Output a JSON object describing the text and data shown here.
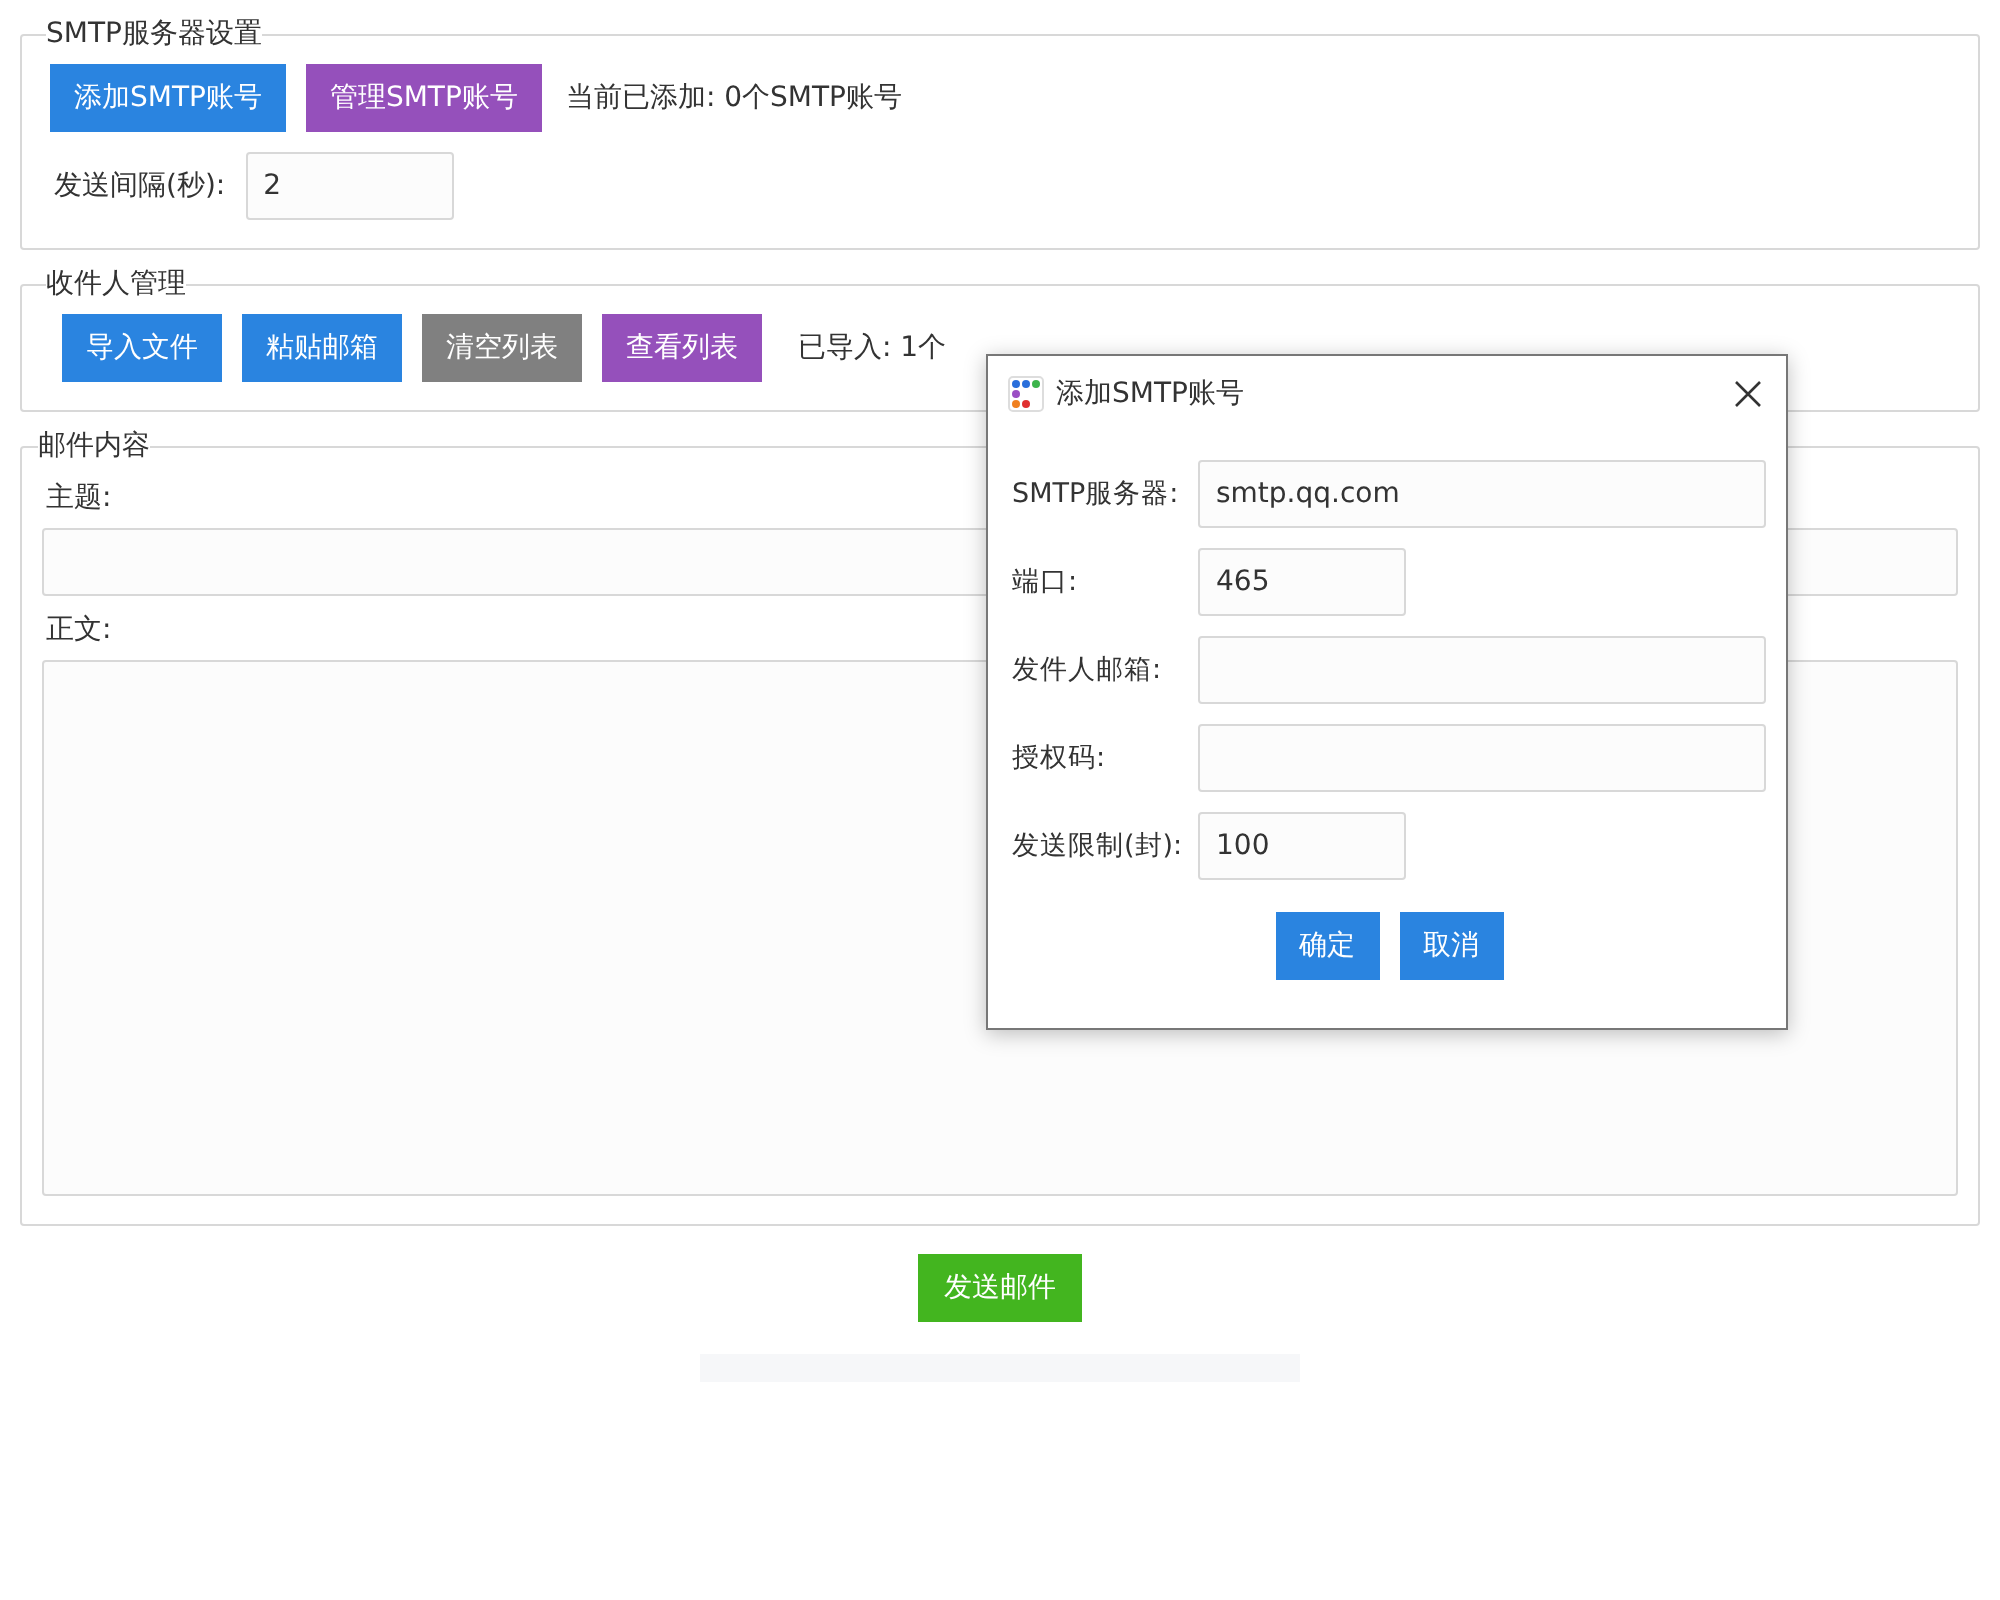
{
  "smtp_settings": {
    "legend": "SMTP服务器设置",
    "buttons": [
      {
        "label": "添加SMTP账号",
        "kind": "primary"
      },
      {
        "label": "管理SMTP账号",
        "kind": "accent"
      }
    ],
    "status": "当前已添加: 0个SMTP账号",
    "interval": {
      "label": "发送间隔(秒):",
      "value": "2"
    }
  },
  "recipients": {
    "legend": "收件人管理",
    "buttons": [
      {
        "label": "导入文件",
        "kind": "primary"
      },
      {
        "label": "粘贴邮箱",
        "kind": "primary"
      },
      {
        "label": "清空列表",
        "kind": "neutral"
      },
      {
        "label": "查看列表",
        "kind": "accent"
      }
    ],
    "status": "已导入: 1个"
  },
  "mail_content": {
    "legend": "邮件内容",
    "subject_label": "主题:",
    "body_label": "正文:"
  },
  "send_button": "发送邮件",
  "dialog": {
    "title": "添加SMTP账号",
    "fields": [
      {
        "label": "SMTP服务器:",
        "value": "smtp.qq.com",
        "kind": "wide"
      },
      {
        "label": "端口:",
        "value": "465",
        "kind": "short"
      },
      {
        "label": "发件人邮箱:",
        "kind": "wide"
      },
      {
        "label": "授权码:",
        "kind": "wide"
      },
      {
        "label": "发送限制(封):",
        "value": "100",
        "kind": "short"
      }
    ],
    "buttons": [
      "确定",
      "取消"
    ]
  }
}
